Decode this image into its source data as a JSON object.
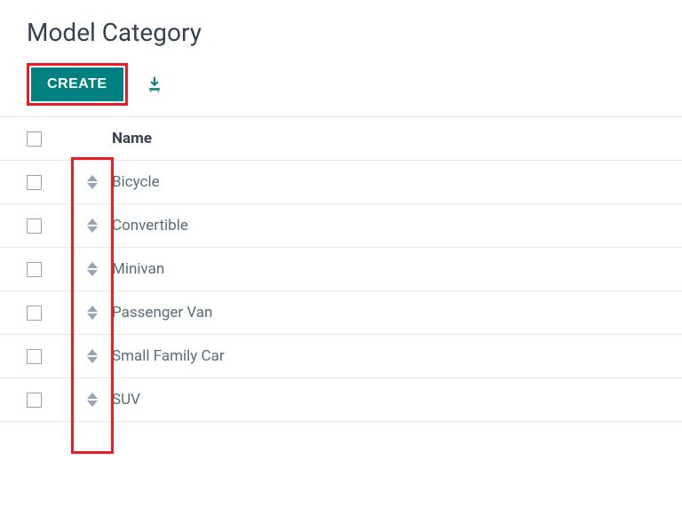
{
  "page": {
    "title": "Model Category"
  },
  "toolbar": {
    "create_label": "CREATE"
  },
  "table": {
    "header": {
      "name_label": "Name"
    },
    "rows": [
      {
        "name": "Bicycle"
      },
      {
        "name": "Convertible"
      },
      {
        "name": "Minivan"
      },
      {
        "name": "Passenger Van"
      },
      {
        "name": "Small Family Car"
      },
      {
        "name": "SUV"
      }
    ]
  }
}
